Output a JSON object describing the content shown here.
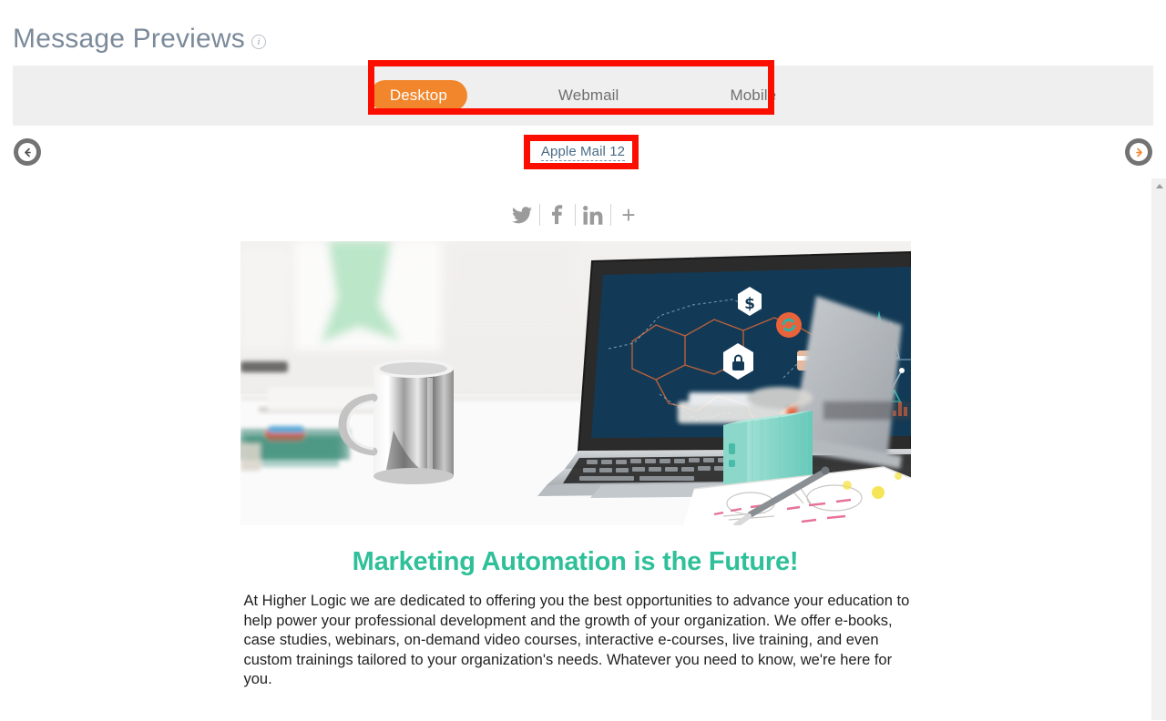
{
  "header": {
    "title": "Message Previews",
    "info_icon": "info-icon",
    "info_glyph": "i"
  },
  "preview_modes": {
    "tabs": [
      {
        "label": "Desktop",
        "active": true
      },
      {
        "label": "Webmail",
        "active": false
      },
      {
        "label": "Mobile",
        "active": false
      }
    ],
    "active_tab": "Desktop",
    "highlight_color": "#fb0d00",
    "active_tab_color": "#f2862c",
    "bar_background": "#efefef"
  },
  "client_selector": {
    "current_client": "Apple Mail 12",
    "prev_arrow_glyph": "←",
    "next_arrow_glyph": "→",
    "prev_label": "Previous preview client",
    "next_label": "Next preview client",
    "next_arrow_color": "#f2862c"
  },
  "email_preview": {
    "social_icons": [
      {
        "name": "twitter-icon",
        "label": "Twitter"
      },
      {
        "name": "facebook-icon",
        "label": "Facebook"
      },
      {
        "name": "linkedin-icon",
        "label": "LinkedIn"
      },
      {
        "name": "plus-icon",
        "label": "+",
        "glyph": "+"
      }
    ],
    "hero_image_alt": "Laptop on a white desk showing a dark blue infographic screen, with a steel mug, a teal speaker cube, notebook and pen",
    "headline": "Marketing Automation is the Future!",
    "headline_color": "#2fc09a",
    "body": "At Higher Logic we are dedicated to offering you the best opportunities to advance your education to help power your professional development and the growth of your organization. We offer e-books, case studies, webinars, on-demand video courses, interactive e-courses, live training, and even custom trainings tailored to your organization's needs. Whatever you need to know, we're here for you."
  },
  "scrollbar": {
    "up_arrow": "scroll-up-arrow",
    "position_percent": 0
  }
}
